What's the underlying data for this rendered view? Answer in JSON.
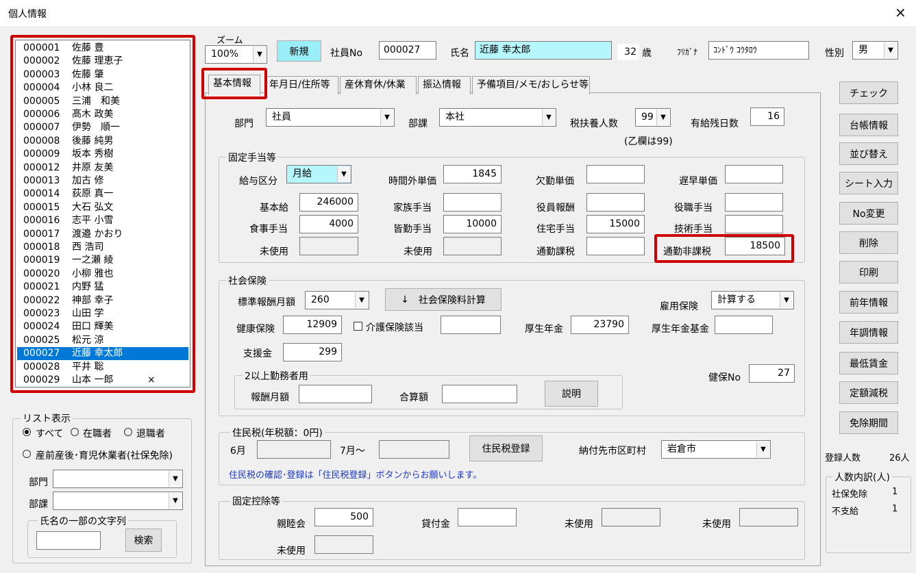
{
  "window": {
    "title": "個人情報",
    "close_icon": "×"
  },
  "employees": [
    {
      "code": "000001",
      "name": "佐藤 豊",
      "mark": ""
    },
    {
      "code": "000002",
      "name": "佐藤 理恵子",
      "mark": ""
    },
    {
      "code": "000003",
      "name": "佐藤 肇",
      "mark": ""
    },
    {
      "code": "000004",
      "name": "小林 良二",
      "mark": ""
    },
    {
      "code": "000005",
      "name": "三浦　和美",
      "mark": ""
    },
    {
      "code": "000006",
      "name": "髙木 政美",
      "mark": ""
    },
    {
      "code": "000007",
      "name": "伊勢　順一",
      "mark": ""
    },
    {
      "code": "000008",
      "name": "後藤 純男",
      "mark": ""
    },
    {
      "code": "000009",
      "name": "坂本 秀樹",
      "mark": ""
    },
    {
      "code": "000012",
      "name": "井原 友美",
      "mark": ""
    },
    {
      "code": "000013",
      "name": "加古 修",
      "mark": ""
    },
    {
      "code": "000014",
      "name": "荻原 真一",
      "mark": ""
    },
    {
      "code": "000015",
      "name": "大石 弘文",
      "mark": ""
    },
    {
      "code": "000016",
      "name": "志平 小雪",
      "mark": ""
    },
    {
      "code": "000017",
      "name": "渡邉 かおり",
      "mark": ""
    },
    {
      "code": "000018",
      "name": "西 浩司",
      "mark": ""
    },
    {
      "code": "000019",
      "name": "一之瀬 綾",
      "mark": ""
    },
    {
      "code": "000020",
      "name": "小柳 雅也",
      "mark": ""
    },
    {
      "code": "000021",
      "name": "内野 猛",
      "mark": ""
    },
    {
      "code": "000022",
      "name": "神部 幸子",
      "mark": ""
    },
    {
      "code": "000023",
      "name": "山田 学",
      "mark": ""
    },
    {
      "code": "000024",
      "name": "田口 輝美",
      "mark": ""
    },
    {
      "code": "000025",
      "name": "松元 涼",
      "mark": ""
    },
    {
      "code": "000027",
      "name": "近藤 幸太郎",
      "mark": "",
      "selected": true
    },
    {
      "code": "000028",
      "name": "平井 聡",
      "mark": ""
    },
    {
      "code": "000029",
      "name": "山本 一郎",
      "mark": "×"
    }
  ],
  "list_display": {
    "legend": "リスト表示",
    "all": "すべて",
    "active": "在職者",
    "retired": "退職者",
    "leave": "産前産後･育児休業者(社保免除)",
    "dept_label": "部門",
    "section_label": "部課",
    "dept_value": "",
    "section_value": "",
    "name_search_legend": "氏名の一部の文字列",
    "search_value": "",
    "search_button": "検索",
    "dropdown_icon": "▼"
  },
  "header": {
    "zoom_label": "ズーム",
    "zoom_value": "100%",
    "new_button": "新規",
    "emp_no_label": "社員No",
    "emp_no": "000027",
    "name_label": "氏名",
    "name": "近藤 幸太郎",
    "age": "32",
    "age_unit": "歳",
    "furigana_label": "ﾌﾘｶﾞﾅ",
    "furigana": "ｺﾝﾄﾞｳ ｺｳﾀﾛｳ",
    "gender_label": "性別",
    "gender": "男"
  },
  "tabs": [
    "基本情報",
    "年月日/住所等",
    "産休育休/休業",
    "振込情報",
    "予備項目/メモ/おしらせ等"
  ],
  "basic": {
    "dept_label": "部門",
    "dept": "社員",
    "section_label": "部課",
    "section": "本社",
    "dependents_label": "税扶養人数",
    "dependents": "99",
    "dependents_note": "(乙欄は99)",
    "leave_label": "有給残日数",
    "leave": "16"
  },
  "fixed": {
    "legend": "固定手当等",
    "pay_type_label": "給与区分",
    "pay_type": "月給",
    "overtime_label": "時間外単価",
    "overtime": "1845",
    "absence_label": "欠勤単価",
    "absence": "",
    "late_label": "遅早単価",
    "late": "",
    "base_label": "基本給",
    "base": "246000",
    "family_label": "家族手当",
    "family": "",
    "officer_label": "役員報酬",
    "officer": "",
    "position_label": "役職手当",
    "position": "",
    "meal_label": "食事手当",
    "meal": "4000",
    "attendance_label": "皆勤手当",
    "attendance": "10000",
    "housing_label": "住宅手当",
    "housing": "15000",
    "tech_label": "技術手当",
    "tech": "",
    "unused1_label": "未使用",
    "unused2_label": "未使用",
    "commute_tax_label": "通勤課税",
    "commute_tax": "",
    "commute_free_label": "通勤非課税",
    "commute_free": "18500"
  },
  "social": {
    "legend": "社会保険",
    "std_label": "標準報酬月額",
    "std": "260",
    "calc_button": "社会保険料計算",
    "calc_icon": "↓",
    "emp_ins_label": "雇用保険",
    "emp_ins": "計算する",
    "health_label": "健康保険",
    "health": "12909",
    "care_label": "介護保険該当",
    "care": "",
    "pension_label": "厚生年金",
    "pension": "23790",
    "fund_label": "厚生年金基金",
    "fund": "",
    "support_label": "支援金",
    "support": "299",
    "multi_legend": "2以上勤務者用",
    "pay_label": "報酬月額",
    "pay": "",
    "sum_label": "合算額",
    "sum": "",
    "explain_button": "説明",
    "health_no_label": "健保No",
    "health_no": "27"
  },
  "resident": {
    "legend": "住民税(年税額：0円)",
    "june_label": "6月",
    "july_label": "7月～",
    "register_button": "住民税登録",
    "city_label": "納付先市区町村",
    "city": "岩倉市",
    "note": "住民税の確認･登録は「住民税登録」ボタンからお願いします。"
  },
  "deduction": {
    "legend": "固定控除等",
    "club_label": "親睦会",
    "club": "500",
    "loan_label": "貸付金",
    "loan": "",
    "unused_a": "未使用",
    "unused_b": "未使用",
    "unused_c": "未使用"
  },
  "side_buttons": [
    "チェック",
    "台帳情報",
    "並び替え",
    "シート入力",
    "No変更",
    "削除",
    "印刷",
    "前年情報",
    "年調情報",
    "最低賃金",
    "定額減税",
    "免除期間"
  ],
  "summary": {
    "count_label": "登録人数",
    "count": "26人",
    "breakdown_legend": "人数内訳(人)",
    "exempt_label": "社保免除",
    "exempt": "1",
    "unpaid_label": "不支給",
    "unpaid": "1"
  },
  "colors": {
    "accent": "#0078d7",
    "highlight": "#d00000",
    "cyan": "#b6f7fd",
    "new_button": "#99eef7"
  }
}
